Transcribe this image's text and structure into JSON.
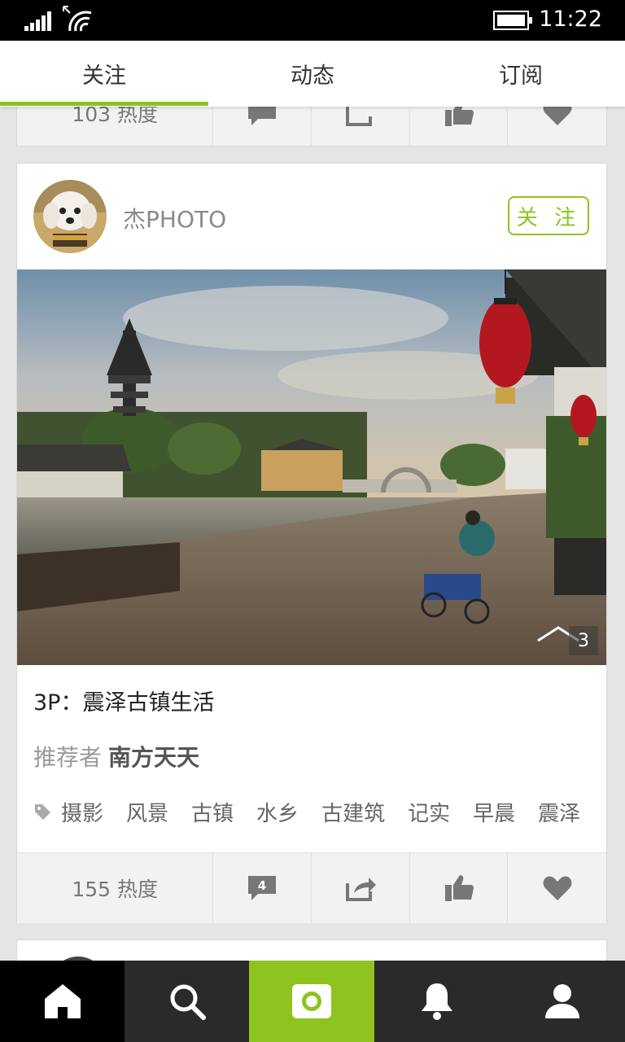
{
  "status_bar": {
    "time": "11:22"
  },
  "tabs": [
    {
      "label": "关注",
      "active": true
    },
    {
      "label": "动态",
      "active": false
    },
    {
      "label": "订阅",
      "active": false
    }
  ],
  "colors": {
    "accent": "#8fc31f",
    "bottom_bar": "#2a2a2a"
  },
  "previous_post": {
    "heat": "103 热度"
  },
  "post": {
    "username": "杰PHOTO",
    "follow_label": "关 注",
    "photo_count": "3",
    "title": "3P：震泽古镇生活",
    "recommender_label": "推荐者",
    "recommender_name": "南方天天",
    "tags": [
      "摄影",
      "风景",
      "古镇",
      "水乡",
      "古建筑",
      "记实",
      "早晨",
      "震泽"
    ],
    "heat": "155 热度",
    "comment_count": "4"
  },
  "bottom_nav": [
    "home-icon",
    "search-icon",
    "camera-icon",
    "bell-icon",
    "user-icon"
  ]
}
